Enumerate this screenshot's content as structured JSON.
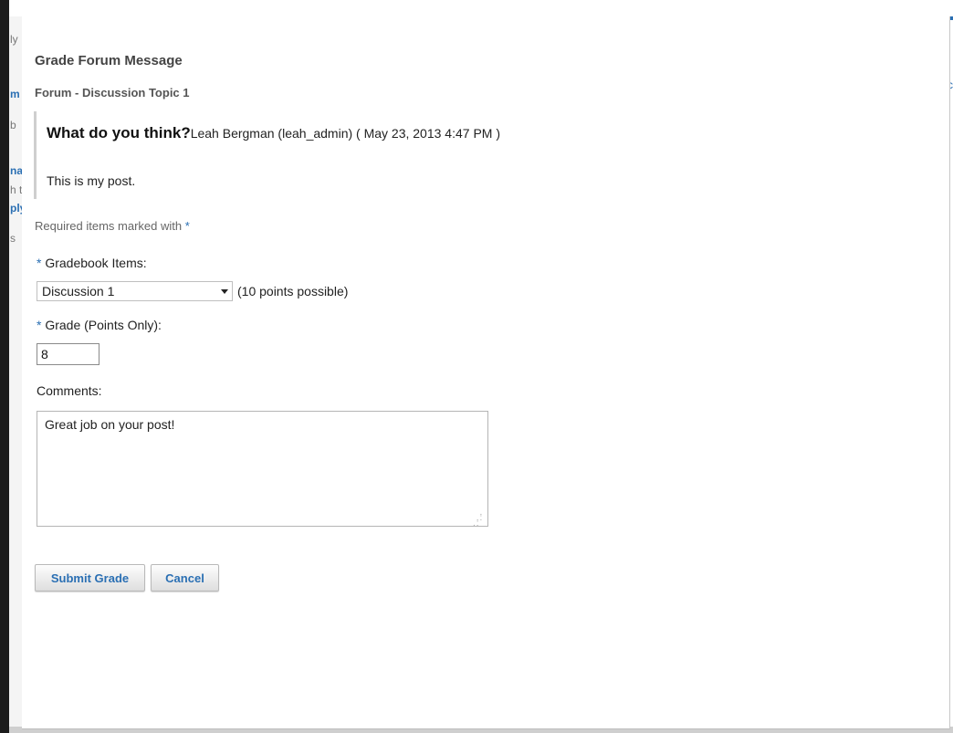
{
  "background_page": {
    "fragments": [
      "ly",
      "m",
      "b",
      "na",
      "h t",
      "ply",
      "s"
    ]
  },
  "dialog": {
    "title": "Grade Forum Message",
    "subtitle": "Forum - Discussion Topic 1",
    "message": {
      "title": "What do you think?",
      "author_line": "Leah Bergman (leah_admin) ( May 23, 2013 4:47 PM )",
      "body": "This is my post."
    },
    "required_note": "Required items marked with",
    "required_marker": "*",
    "gradebook": {
      "label": "Gradebook Items:",
      "selected": "Discussion 1",
      "points_note": "(10 points possible)"
    },
    "grade": {
      "label": "Grade (Points Only):",
      "value": "8"
    },
    "comments": {
      "label": "Comments:",
      "value": "Great job on your post!"
    },
    "buttons": {
      "submit": "Submit Grade",
      "cancel": "Cancel"
    }
  },
  "colors": {
    "accent": "#2a6fb3",
    "window_edge": "#1c1c1c"
  }
}
